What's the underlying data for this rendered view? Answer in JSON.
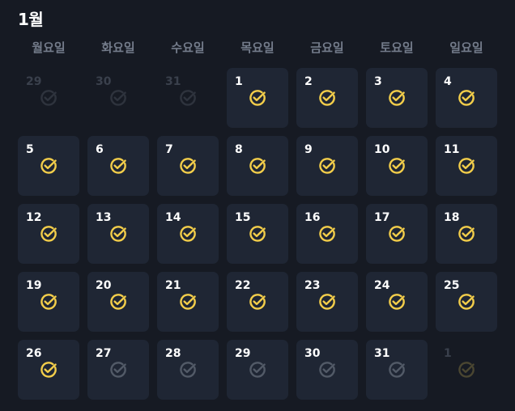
{
  "month_title": "1월",
  "weekdays": [
    "월요일",
    "화요일",
    "수요일",
    "목요일",
    "금요일",
    "토요일",
    "일요일"
  ],
  "colors": {
    "checked": "#f2cd4a",
    "unchecked": "#525a67",
    "outside_check": "#2e333d",
    "outside_next_check": "#4a4631"
  },
  "days": [
    {
      "day": "29",
      "in_month": false,
      "status": "none"
    },
    {
      "day": "30",
      "in_month": false,
      "status": "none"
    },
    {
      "day": "31",
      "in_month": false,
      "status": "none"
    },
    {
      "day": "1",
      "in_month": true,
      "status": "checked"
    },
    {
      "day": "2",
      "in_month": true,
      "status": "checked"
    },
    {
      "day": "3",
      "in_month": true,
      "status": "checked"
    },
    {
      "day": "4",
      "in_month": true,
      "status": "checked"
    },
    {
      "day": "5",
      "in_month": true,
      "status": "checked"
    },
    {
      "day": "6",
      "in_month": true,
      "status": "checked"
    },
    {
      "day": "7",
      "in_month": true,
      "status": "checked"
    },
    {
      "day": "8",
      "in_month": true,
      "status": "checked"
    },
    {
      "day": "9",
      "in_month": true,
      "status": "checked"
    },
    {
      "day": "10",
      "in_month": true,
      "status": "checked"
    },
    {
      "day": "11",
      "in_month": true,
      "status": "checked"
    },
    {
      "day": "12",
      "in_month": true,
      "status": "checked"
    },
    {
      "day": "13",
      "in_month": true,
      "status": "checked"
    },
    {
      "day": "14",
      "in_month": true,
      "status": "checked"
    },
    {
      "day": "15",
      "in_month": true,
      "status": "checked"
    },
    {
      "day": "16",
      "in_month": true,
      "status": "checked"
    },
    {
      "day": "17",
      "in_month": true,
      "status": "checked"
    },
    {
      "day": "18",
      "in_month": true,
      "status": "checked"
    },
    {
      "day": "19",
      "in_month": true,
      "status": "checked"
    },
    {
      "day": "20",
      "in_month": true,
      "status": "checked"
    },
    {
      "day": "21",
      "in_month": true,
      "status": "checked"
    },
    {
      "day": "22",
      "in_month": true,
      "status": "checked"
    },
    {
      "day": "23",
      "in_month": true,
      "status": "checked"
    },
    {
      "day": "24",
      "in_month": true,
      "status": "checked"
    },
    {
      "day": "25",
      "in_month": true,
      "status": "checked"
    },
    {
      "day": "26",
      "in_month": true,
      "status": "checked"
    },
    {
      "day": "27",
      "in_month": true,
      "status": "unchecked"
    },
    {
      "day": "28",
      "in_month": true,
      "status": "unchecked"
    },
    {
      "day": "29",
      "in_month": true,
      "status": "unchecked"
    },
    {
      "day": "30",
      "in_month": true,
      "status": "unchecked"
    },
    {
      "day": "31",
      "in_month": true,
      "status": "unchecked"
    },
    {
      "day": "1",
      "in_month": false,
      "status": "next"
    }
  ]
}
